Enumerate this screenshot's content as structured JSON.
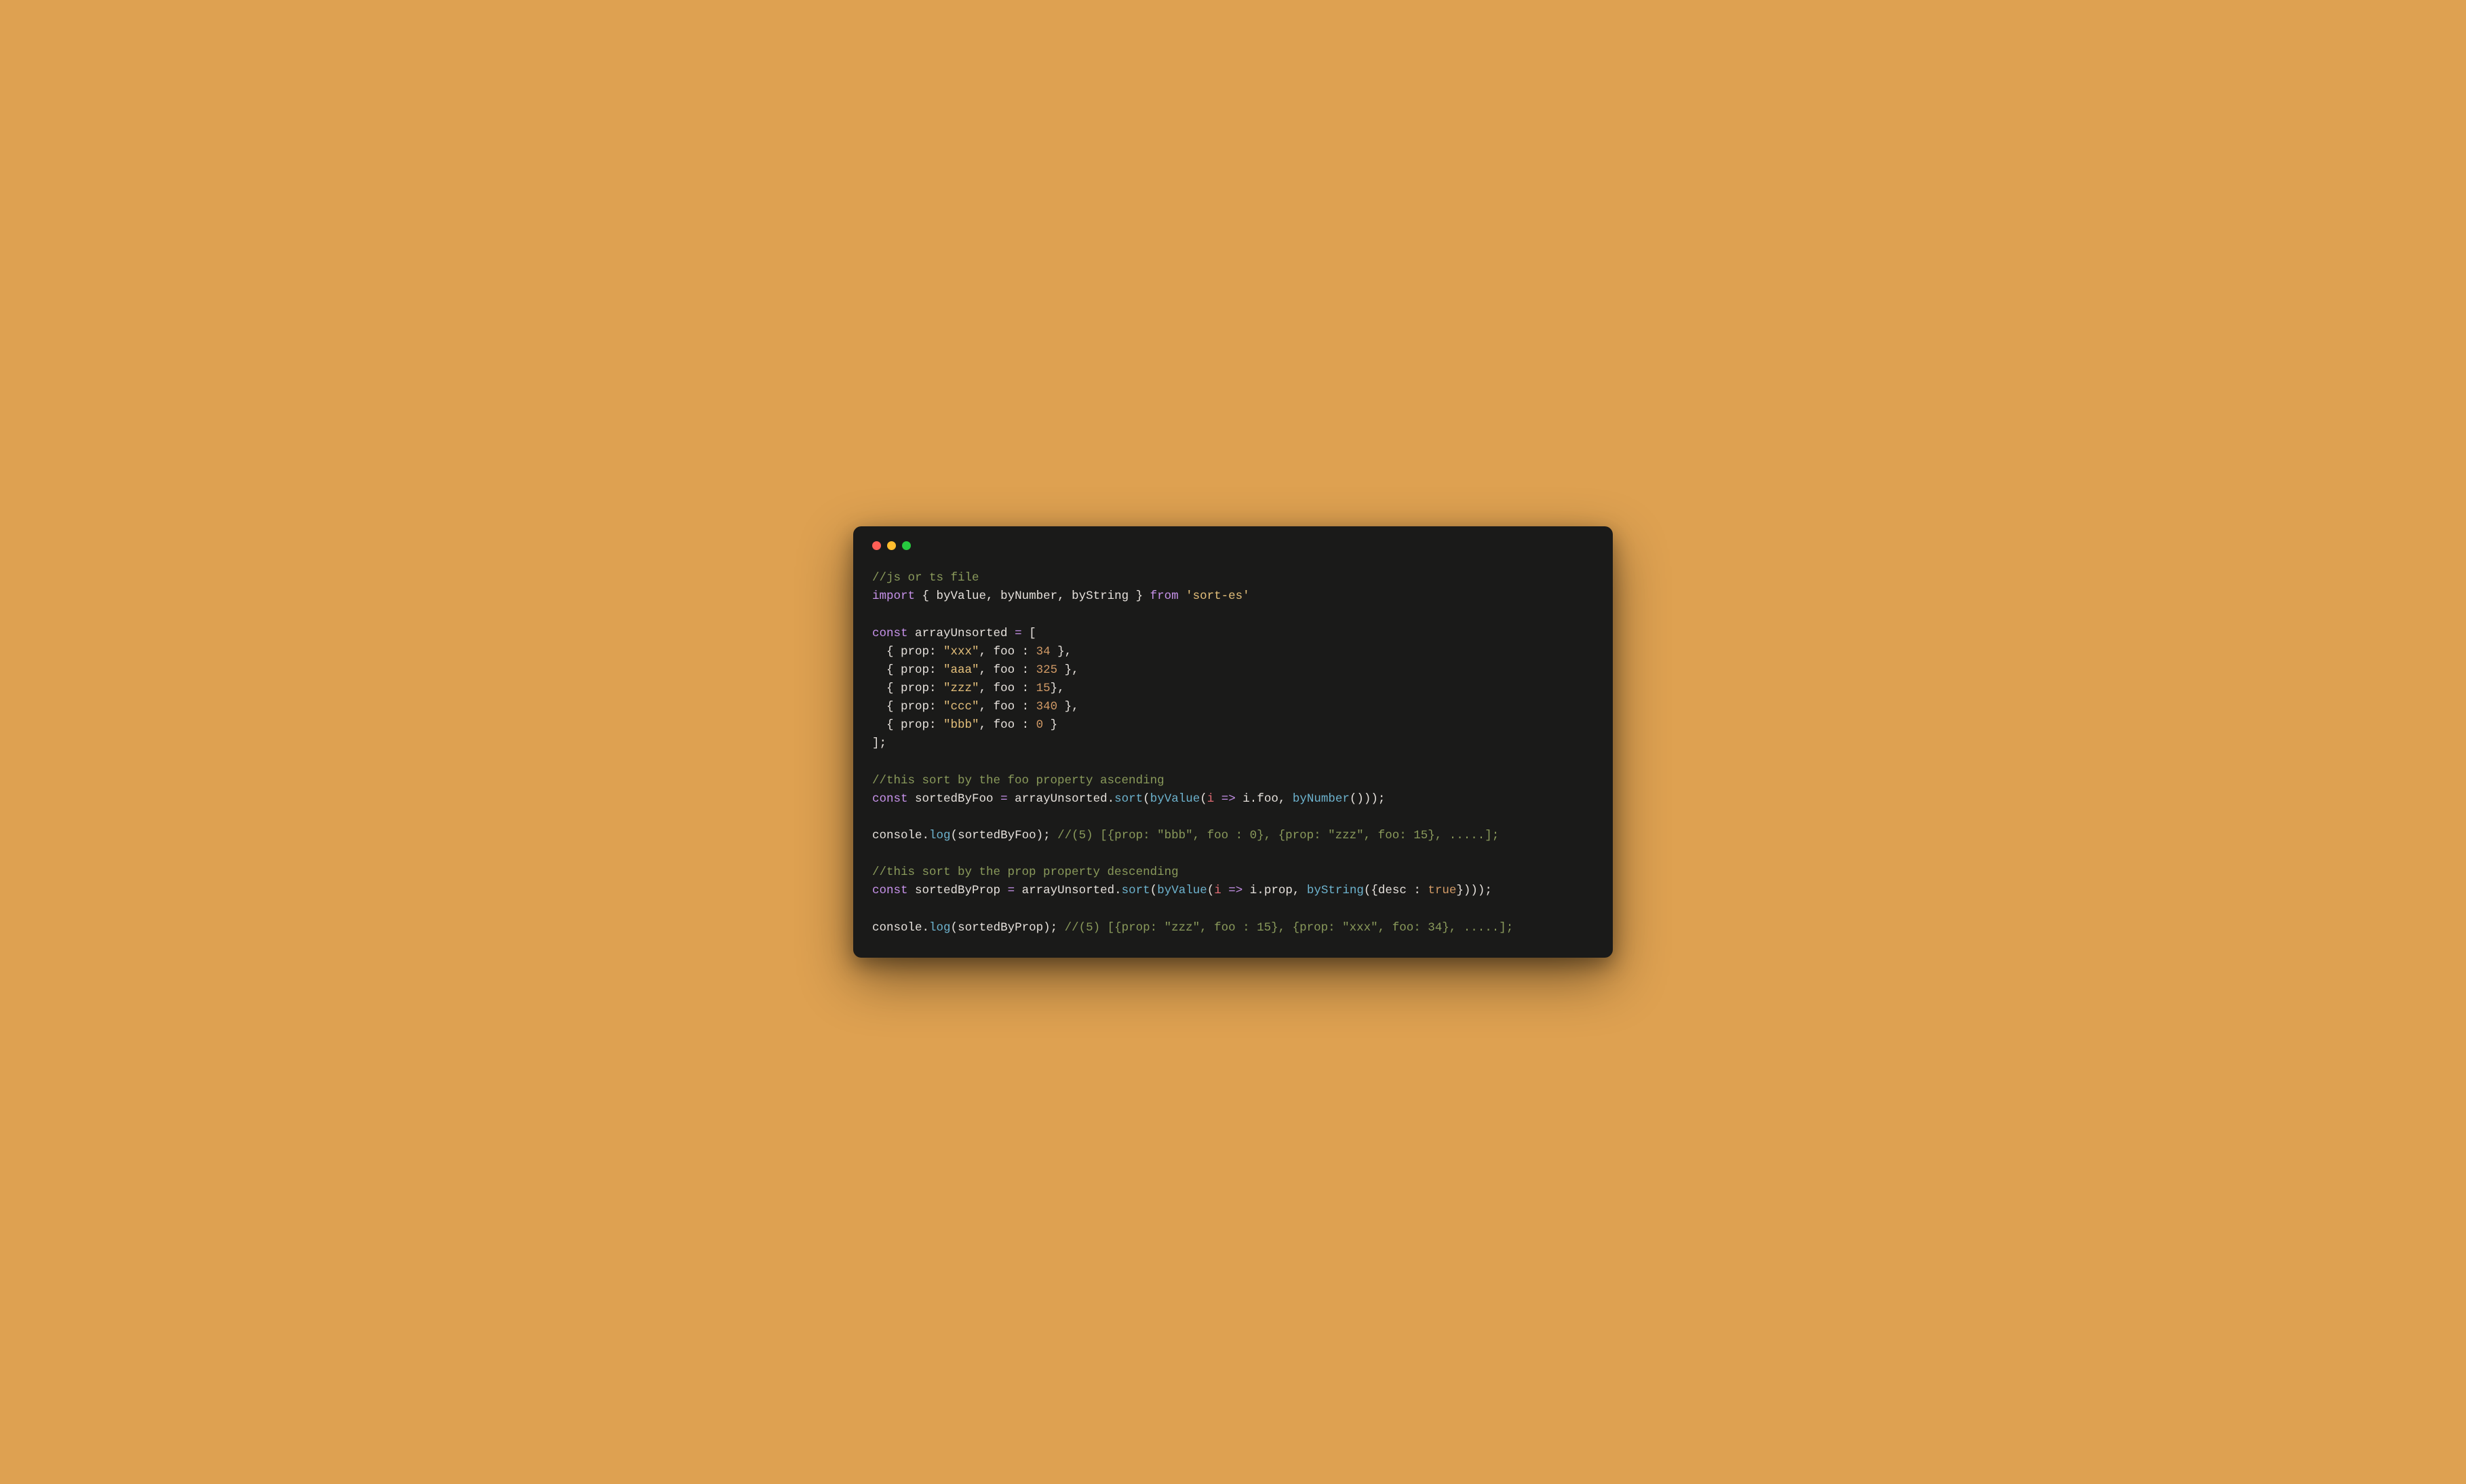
{
  "colors": {
    "background": "#dea151",
    "window": "#1a1a19",
    "dot_red": "#ff5f56",
    "dot_yellow": "#ffbd2e",
    "dot_green": "#27c93f",
    "comment": "#8a9a5b",
    "keyword": "#c792ea",
    "identifier": "#e6e1dc",
    "string": "#e5c07b",
    "number": "#d19a66",
    "call": "#6db3ce",
    "param": "#e06c75"
  },
  "code": {
    "c1": "//js or ts file",
    "kw_import": "import",
    "imp_byValue": "byValue",
    "imp_byNumber": "byNumber",
    "imp_byString": "byString",
    "kw_from": "from",
    "str_module": "'sort-es'",
    "kw_const1": "const",
    "var_arrayUnsorted": "arrayUnsorted",
    "op_eq": "=",
    "arr_open": "[",
    "obj_row1_prop_key": "prop",
    "obj_row1_prop_val": "\"xxx\"",
    "obj_row1_foo_key": "foo",
    "obj_row1_foo_val": "34",
    "obj_row2_prop_val": "\"aaa\"",
    "obj_row2_foo_val": "325",
    "obj_row3_prop_val": "\"zzz\"",
    "obj_row3_foo_val": "15",
    "obj_row4_prop_val": "\"ccc\"",
    "obj_row4_foo_val": "340",
    "obj_row5_prop_val": "\"bbb\"",
    "obj_row5_foo_val": "0",
    "arr_close": "];",
    "c2": "//this sort by the foo property ascending",
    "kw_const2": "const",
    "var_sortedByFoo": "sortedByFoo",
    "call_sort": "sort",
    "call_byValue": "byValue",
    "param_i": "i",
    "arrow": "=>",
    "prop_foo": "foo",
    "call_byNumber": "byNumber",
    "console": "console",
    "call_log": "log",
    "c3": "//(5) [{prop: \"bbb\", foo : 0}, {prop: \"zzz\", foo: 15}, .....];",
    "c4": "//this sort by the prop property descending",
    "kw_const3": "const",
    "var_sortedByProp": "sortedByProp",
    "prop_prop": "prop",
    "call_byString": "byString",
    "desc_key": "desc",
    "bool_true": "true",
    "c5": "//(5) [{prop: \"zzz\", foo : 15}, {prop: \"xxx\", foo: 34}, .....];"
  }
}
